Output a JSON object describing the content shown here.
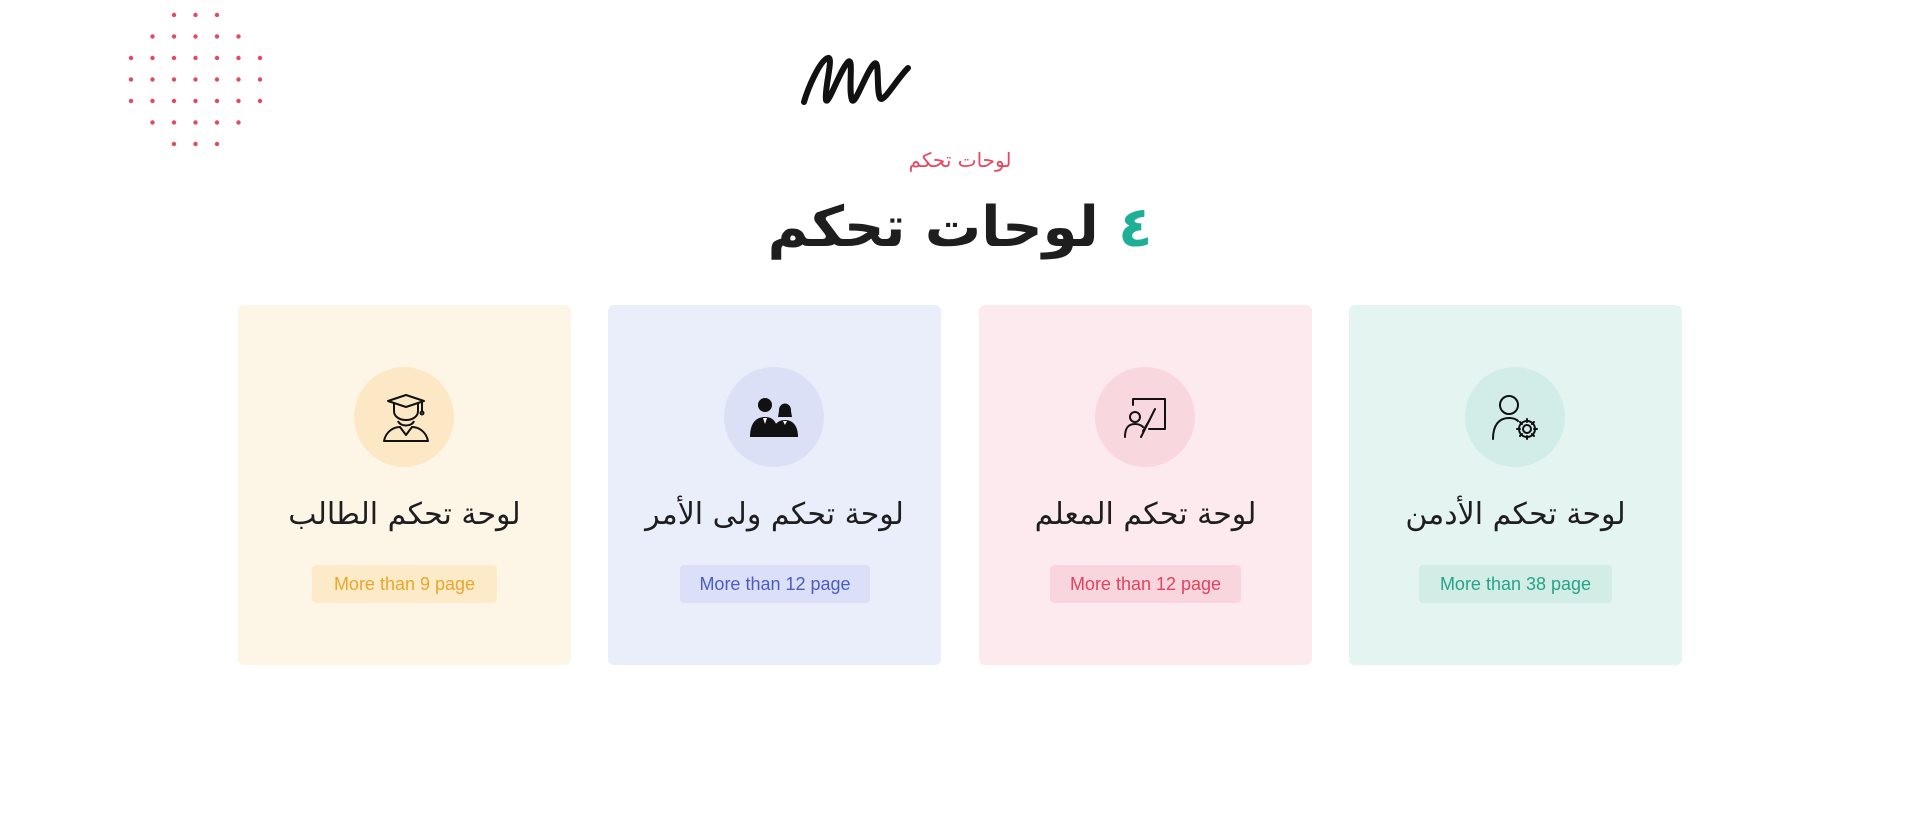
{
  "section": {
    "eyebrow": "لوحات تحكم",
    "heading_number": "٤",
    "heading_text": "لوحات تحكم"
  },
  "cards": [
    {
      "title": "لوحة تحكم الطالب",
      "badge": "More than 9 page",
      "icon": "student-graduate-icon"
    },
    {
      "title": "لوحة تحكم ولى الأمر",
      "badge": "More than 12 page",
      "icon": "parents-icon"
    },
    {
      "title": "لوحة تحكم المعلم",
      "badge": "More than 12 page",
      "icon": "teacher-board-icon"
    },
    {
      "title": "لوحة تحكم الأدمن",
      "badge": "More than 38 page",
      "icon": "admin-user-gear-icon"
    }
  ],
  "colors": {
    "accent_red": "#e5485f",
    "accent_green": "#1fae96",
    "student": "#e9a72a",
    "parent": "#4a5cc9",
    "teacher": "#e0435c",
    "admin": "#26a388"
  }
}
